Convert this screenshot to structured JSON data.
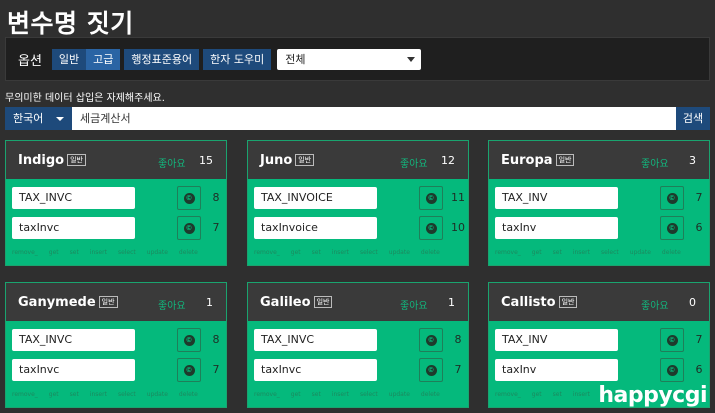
{
  "page": {
    "title": "변수명 짓기"
  },
  "options": {
    "label": "옵션",
    "buttons": [
      "일반",
      "고급",
      "행정표준용어",
      "한자 도우미"
    ],
    "active_index": 1,
    "select_value": "전체"
  },
  "notice": "무의미한 데이터 삽입은 자제해주세요.",
  "search": {
    "language": "한국어",
    "query": "세금계산서",
    "button_label": "검색"
  },
  "card_labels": {
    "badge": "일반",
    "like": "좋아요",
    "copy_glyph": "©"
  },
  "methods": [
    "remove_",
    "get",
    "set",
    "insert",
    "select",
    "update",
    "delete"
  ],
  "cards": [
    {
      "name": "Indigo",
      "likes": "15",
      "rows": [
        {
          "value": "TAX_INVC",
          "count": "8"
        },
        {
          "value": "taxInvc",
          "count": "7"
        }
      ]
    },
    {
      "name": "Juno",
      "likes": "12",
      "rows": [
        {
          "value": "TAX_INVOICE",
          "count": "11"
        },
        {
          "value": "taxInvoice",
          "count": "10"
        }
      ]
    },
    {
      "name": "Europa",
      "likes": "3",
      "rows": [
        {
          "value": "TAX_INV",
          "count": "7"
        },
        {
          "value": "taxInv",
          "count": "6"
        }
      ]
    },
    {
      "name": "Ganymede",
      "likes": "1",
      "rows": [
        {
          "value": "TAX_INVC",
          "count": "8"
        },
        {
          "value": "taxInvc",
          "count": "7"
        }
      ]
    },
    {
      "name": "Galileo",
      "likes": "1",
      "rows": [
        {
          "value": "TAX_INVC",
          "count": "8"
        },
        {
          "value": "taxInvc",
          "count": "7"
        }
      ]
    },
    {
      "name": "Callisto",
      "likes": "0",
      "rows": [
        {
          "value": "TAX_INV",
          "count": "7"
        },
        {
          "value": "taxInv",
          "count": "6"
        }
      ]
    }
  ],
  "watermark": "happycgi"
}
